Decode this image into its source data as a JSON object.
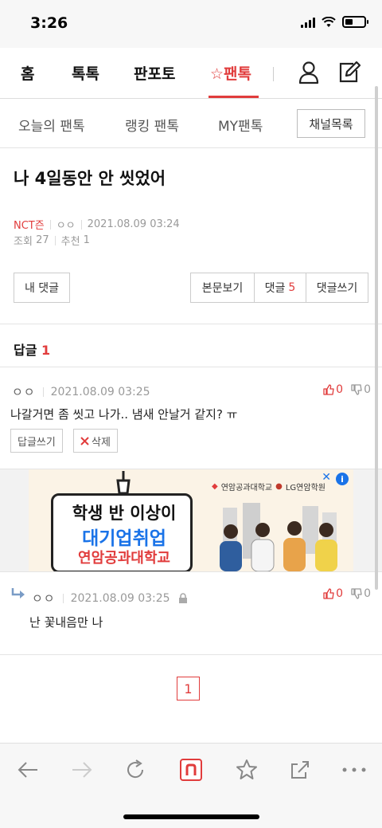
{
  "status_bar": {
    "time": "3:26"
  },
  "main_nav": {
    "tabs": [
      {
        "label": "홈"
      },
      {
        "label": "톡톡"
      },
      {
        "label": "판포토"
      },
      {
        "label": "☆팬톡"
      }
    ]
  },
  "sub_nav": {
    "tabs": [
      {
        "label": "오늘의 팬톡"
      },
      {
        "label": "랭킹 팬톡"
      },
      {
        "label": "MY팬톡"
      }
    ],
    "channel_list_label": "채널목록"
  },
  "post": {
    "title": "나 4일동안 안 씻었어",
    "channel": "NCT즌",
    "author": "ㅇㅇ",
    "date": "2021.08.09 03:24",
    "views_label": "조회",
    "views": "27",
    "recommend_label": "추천",
    "recommend": "1"
  },
  "actions": {
    "my_comments": "내 댓글",
    "view_post": "본문보기",
    "comments_label": "댓글",
    "comments_count": "5",
    "write_comment": "댓글쓰기"
  },
  "replies": {
    "heading": "답글",
    "count": "1"
  },
  "comments": [
    {
      "author": "ㅇㅇ",
      "date": "2021.08.09 03:25",
      "text": "나갈거면 좀 씻고 나가.. 냄새 안날거 같지? ㅠ",
      "up": "0",
      "down": "0",
      "reply_label": "답글쓰기",
      "delete_label": "삭제"
    },
    {
      "author": "ㅇㅇ",
      "date": "2021.08.09 03:25",
      "text": "난 꽃내음만 나",
      "up": "0",
      "down": "0"
    }
  ],
  "ad": {
    "line1": "학생 반 이상이",
    "line2": "대기업취업",
    "line3": "연암공과대학교",
    "brand1": "연암공과대학교",
    "brand2": "LG연암학원"
  },
  "pagination": {
    "current": "1"
  },
  "colors": {
    "accent": "#e13c3c",
    "ad_blue": "#1a73e8"
  }
}
